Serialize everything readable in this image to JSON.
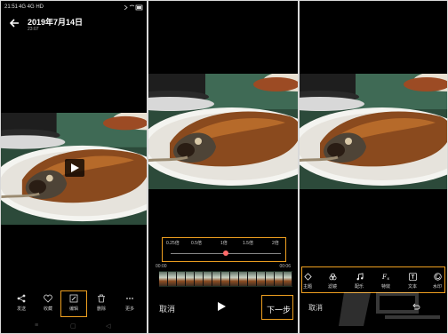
{
  "screen1": {
    "status": {
      "time": "21:51",
      "indicators": "4G 4G HD",
      "right_icons": "bt-wifi-battery"
    },
    "header": {
      "title": "2019年7月14日",
      "subtitle": "23:07"
    },
    "actions": [
      {
        "label": "发送",
        "icon": "share-icon"
      },
      {
        "label": "收藏",
        "icon": "heart-icon"
      },
      {
        "label": "编辑",
        "icon": "edit-icon"
      },
      {
        "label": "删除",
        "icon": "trash-icon"
      },
      {
        "label": "更多",
        "icon": "more-icon"
      }
    ]
  },
  "screen2": {
    "speeds": [
      "0.25倍",
      "0.5倍",
      "1倍",
      "1.5倍",
      "2倍"
    ],
    "selected_speed": "1倍",
    "time_start": "00:00",
    "time_end": "00:06",
    "cancel": "取消",
    "next": "下一步"
  },
  "screen3": {
    "tools": [
      {
        "label": "主题",
        "icon": "theme-icon"
      },
      {
        "label": "滤镜",
        "icon": "filter-icon"
      },
      {
        "label": "配乐",
        "icon": "music-icon"
      },
      {
        "label": "特效",
        "icon": "effects-icon"
      },
      {
        "label": "文本",
        "icon": "text-icon"
      },
      {
        "label": "水印",
        "icon": "watermark-icon"
      }
    ],
    "cancel": "取消"
  },
  "colors": {
    "highlight": "#f0a020",
    "speed_thumb": "#ff6a6a",
    "background": "#000000"
  }
}
